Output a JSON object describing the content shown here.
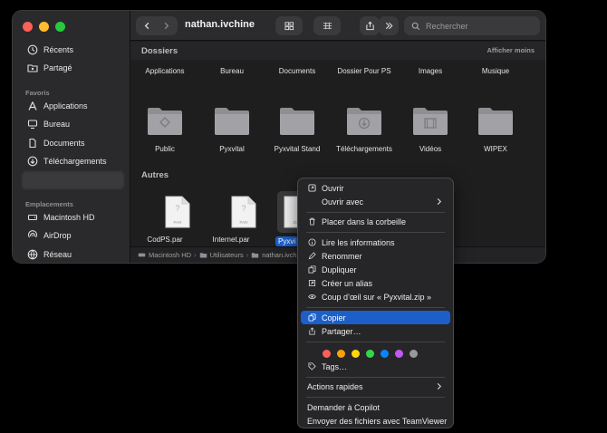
{
  "window": {
    "title": "nathan.ivchine"
  },
  "search": {
    "placeholder": "Rechercher"
  },
  "sidebar": {
    "top_items": [
      {
        "label": "Récents",
        "icon": "clock-icon"
      },
      {
        "label": "Partagé",
        "icon": "shared-folder-icon"
      }
    ],
    "favoris_header": "Favoris",
    "favoris": [
      {
        "label": "Applications",
        "icon": "applications-icon"
      },
      {
        "label": "Bureau",
        "icon": "desktop-icon"
      },
      {
        "label": "Documents",
        "icon": "document-icon"
      },
      {
        "label": "Téléchargements",
        "icon": "download-icon"
      }
    ],
    "emplacements_header": "Emplacements",
    "emplacements": [
      {
        "label": "Macintosh HD",
        "icon": "disk-icon"
      },
      {
        "label": "AirDrop",
        "icon": "airdrop-icon"
      },
      {
        "label": "Réseau",
        "icon": "network-icon"
      }
    ]
  },
  "sections": {
    "dossiers": "Dossiers",
    "afficher_moins": "Afficher moins",
    "autres": "Autres"
  },
  "dossiers_row1": [
    "Applications",
    "Bureau",
    "Documents",
    "Dossier Pour PS",
    "Images",
    "Musique"
  ],
  "dossiers_row2": [
    "Public",
    "Pyxvital",
    "Pyxvital Stand",
    "Téléchargements",
    "Vidéos",
    "WIPEX"
  ],
  "autres": [
    {
      "label": "CodPS.par",
      "badge": "PAR"
    },
    {
      "label": "Internet.par",
      "badge": "PAR"
    },
    {
      "label": "Pyxvi",
      "badge": "ZIP"
    }
  ],
  "pathbar": [
    "Macintosh HD",
    "Utilisateurs",
    "nathan.ivchi"
  ],
  "context_menu": {
    "ouvrir": "Ouvrir",
    "ouvrir_avec": "Ouvrir avec",
    "corbeille": "Placer dans la corbeille",
    "infos": "Lire les informations",
    "renommer": "Renommer",
    "dupliquer": "Dupliquer",
    "alias": "Créer un alias",
    "coup_oeil": "Coup d’œil sur « Pyxvital.zip »",
    "copier": "Copier",
    "partager": "Partager…",
    "tag_colors": [
      "#ff5f57",
      "#ff9f0a",
      "#ffd60a",
      "#32d74b",
      "#0a84ff",
      "#bf5af2",
      "#98989d"
    ],
    "tags": "Tags…",
    "actions_rapides": "Actions rapides",
    "copilot": "Demander à Copilot",
    "teamviewer": "Envoyer des fichiers avec TeamViewer"
  }
}
